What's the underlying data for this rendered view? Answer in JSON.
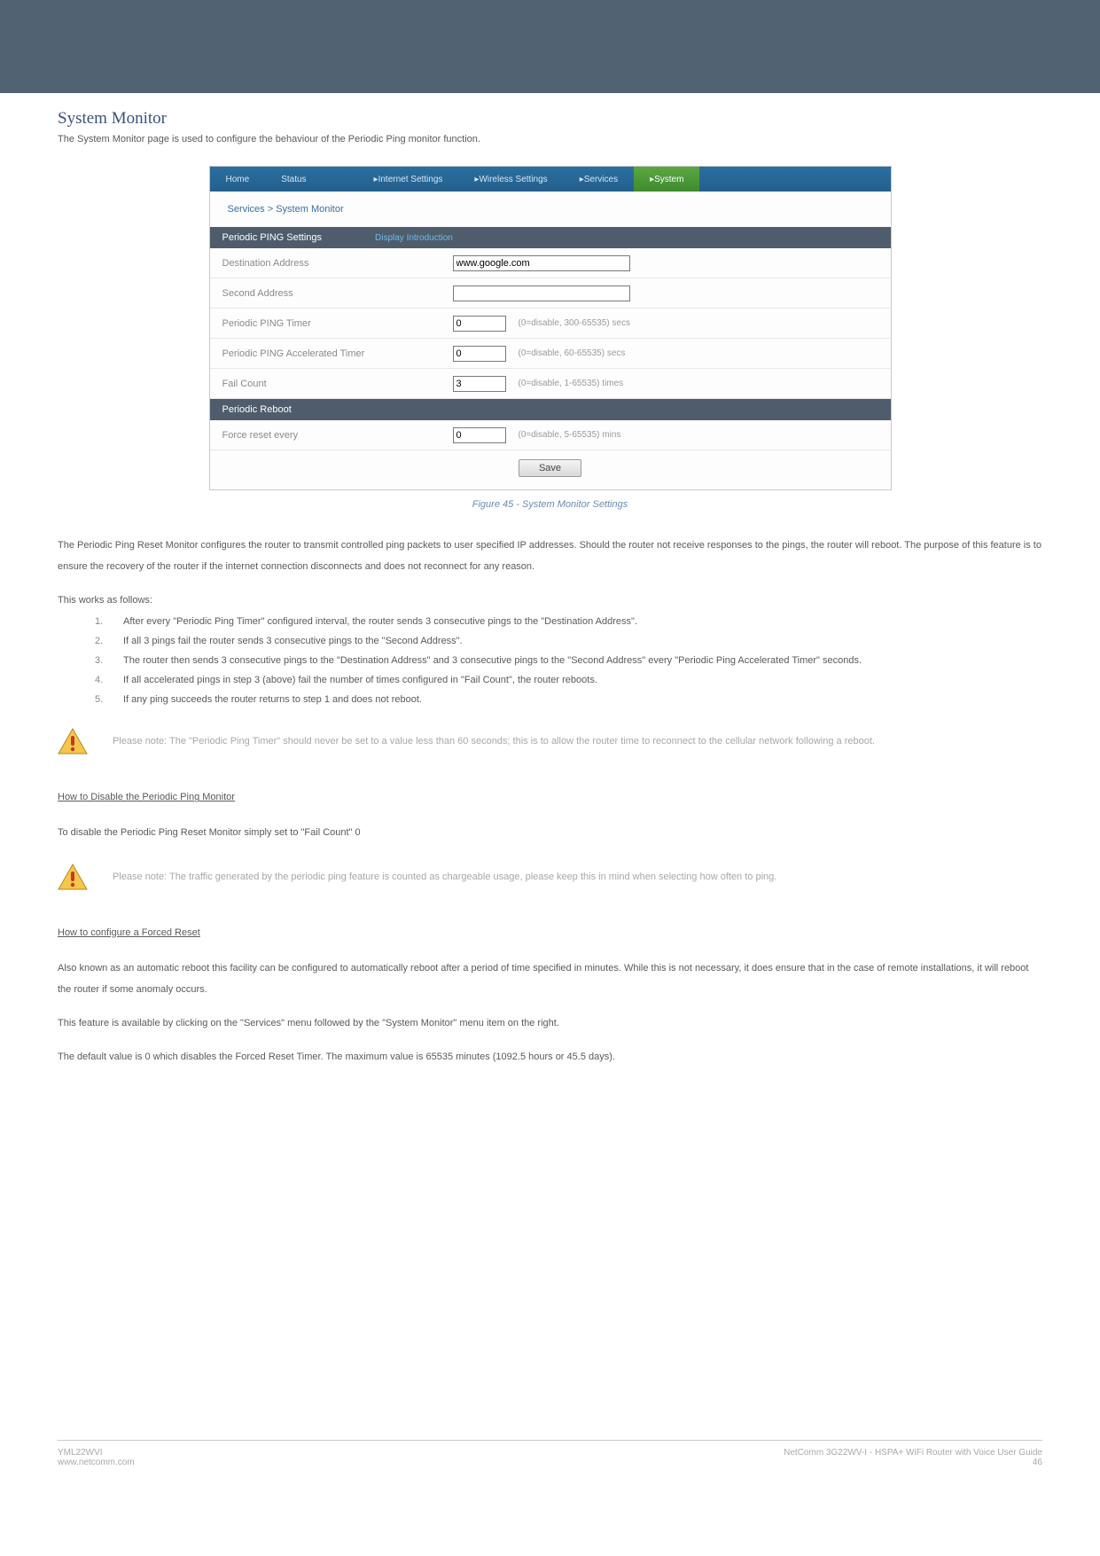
{
  "page": {
    "title": "System Monitor",
    "intro": "The System Monitor page is used to configure the behaviour of the Periodic Ping monitor function.",
    "figure_caption": "Figure 45 - System Monitor Settings"
  },
  "ui": {
    "tabs": {
      "home": "Home",
      "status": "Status",
      "internet": "Internet Settings",
      "wireless": "Wireless Settings",
      "services": "Services",
      "system": "System"
    },
    "breadcrumb": "Services > System Monitor",
    "section1_title": "Periodic PING Settings",
    "section1_link": "Display Introduction",
    "rows": {
      "dest_label": "Destination Address",
      "dest_value": "www.google.com",
      "second_label": "Second Address",
      "second_value": "",
      "timer_label": "Periodic PING Timer",
      "timer_value": "0",
      "timer_hint": "(0=disable, 300-65535) secs",
      "acc_label": "Periodic PING Accelerated Timer",
      "acc_value": "0",
      "acc_hint": "(0=disable, 60-65535) secs",
      "fail_label": "Fail Count",
      "fail_value": "3",
      "fail_hint": "(0=disable, 1-65535) times"
    },
    "section2_title": "Periodic Reboot",
    "reboot": {
      "label": "Force reset every",
      "value": "0",
      "hint": "(0=disable, 5-65535) mins"
    },
    "save_label": "Save"
  },
  "body": {
    "p1": "The Periodic Ping Reset Monitor configures the router to transmit controlled ping packets to user specified IP addresses. Should the router not receive responses to the pings, the router will reboot. The purpose of this feature is to ensure the recovery of the router if the internet connection disconnects and does not reconnect for any reason.",
    "p2": "This works as follows:",
    "steps": [
      "After every \"Periodic Ping Timer\" configured interval, the router sends 3 consecutive pings to the \"Destination Address\".",
      "If all 3 pings fail the router sends 3 consecutive pings to the \"Second Address\".",
      "The router then sends 3 consecutive pings to the \"Destination Address\" and 3 consecutive pings to the \"Second Address\" every \"Periodic Ping Accelerated Timer\" seconds.",
      "If all accelerated pings in step 3 (above) fail the number of times configured in \"Fail Count\", the router reboots.",
      "If any ping succeeds the router returns to step 1 and does not reboot."
    ],
    "note1": "Please note: The \"Periodic Ping Timer\" should never be set to a value less than 60 seconds; this is to allow the router time to reconnect to the cellular network following a reboot.",
    "h1": "How to Disable the Periodic Ping Monitor",
    "p3": "To disable the Periodic Ping Reset Monitor simply set to \"Fail Count\" 0",
    "note2": "Please note: The traffic generated by the periodic ping feature is counted as chargeable usage, please keep this in mind when selecting how often to ping.",
    "h2": "How to configure a Forced Reset",
    "p4": "Also known as an automatic reboot this facility can be configured to automatically reboot after a period of time specified in minutes. While this is not necessary, it does ensure that in the case of remote installations, it will reboot the router if some anomaly occurs.",
    "p5": "This feature is available by clicking on the \"Services\" menu followed by the \"System Monitor\" menu item on the right.",
    "p6": "The default value is 0 which disables the Forced Reset Timer. The maximum value is 65535 minutes (1092.5 hours or 45.5 days)."
  },
  "footer": {
    "left1": "YML22WVI",
    "left2": "www.netcomm.com",
    "right1": "NetComm 3G22WV-I - HSPA+ WiFi Router with Voice User Guide",
    "right2": "46"
  }
}
